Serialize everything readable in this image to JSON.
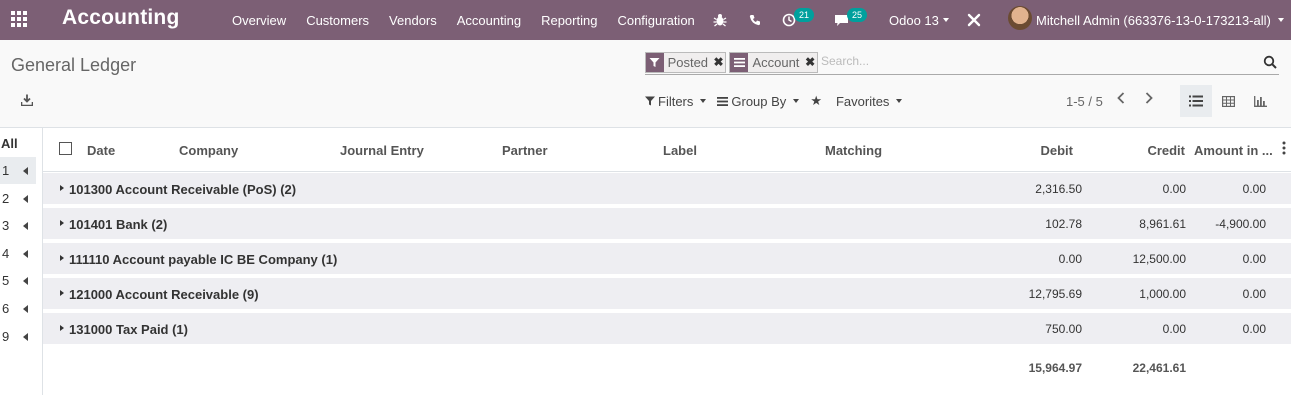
{
  "navbar": {
    "app_title": "Accounting",
    "menu": [
      "Overview",
      "Customers",
      "Vendors",
      "Accounting",
      "Reporting",
      "Configuration"
    ],
    "activity_count": "21",
    "messages_count": "25",
    "database": "Odoo 13",
    "user": "Mitchell Admin (663376-13-0-173213-all)"
  },
  "control_panel": {
    "title": "General Ledger",
    "facets": [
      {
        "icon": "filter-icon",
        "label": "Posted"
      },
      {
        "icon": "group-icon",
        "label": "Account"
      }
    ],
    "search_placeholder": "Search...",
    "filters_label": "Filters",
    "groupby_label": "Group By",
    "favorites_label": "Favorites",
    "pager": "1-5 / 5"
  },
  "left_panel": {
    "all_label": "All",
    "items": [
      "1",
      "2",
      "3",
      "4",
      "5",
      "6",
      "9"
    ]
  },
  "table": {
    "headers": {
      "date": "Date",
      "company": "Company",
      "journal_entry": "Journal Entry",
      "partner": "Partner",
      "label": "Label",
      "matching": "Matching",
      "debit": "Debit",
      "credit": "Credit",
      "amount": "Amount in ..."
    },
    "groups": [
      {
        "name": "101300 Account Receivable (PoS) (2)",
        "debit": "2,316.50",
        "credit": "0.00",
        "amount": "0.00"
      },
      {
        "name": "101401 Bank (2)",
        "debit": "102.78",
        "credit": "8,961.61",
        "amount": "-4,900.00"
      },
      {
        "name": "111110 Account payable IC BE Company (1)",
        "debit": "0.00",
        "credit": "12,500.00",
        "amount": "0.00"
      },
      {
        "name": "121000 Account Receivable (9)",
        "debit": "12,795.69",
        "credit": "1,000.00",
        "amount": "0.00"
      },
      {
        "name": "131000 Tax Paid (1)",
        "debit": "750.00",
        "credit": "0.00",
        "amount": "0.00"
      }
    ],
    "totals": {
      "debit": "15,964.97",
      "credit": "22,461.61"
    }
  },
  "colors": {
    "brand": "#7c5f75",
    "badge": "#00a09d"
  }
}
